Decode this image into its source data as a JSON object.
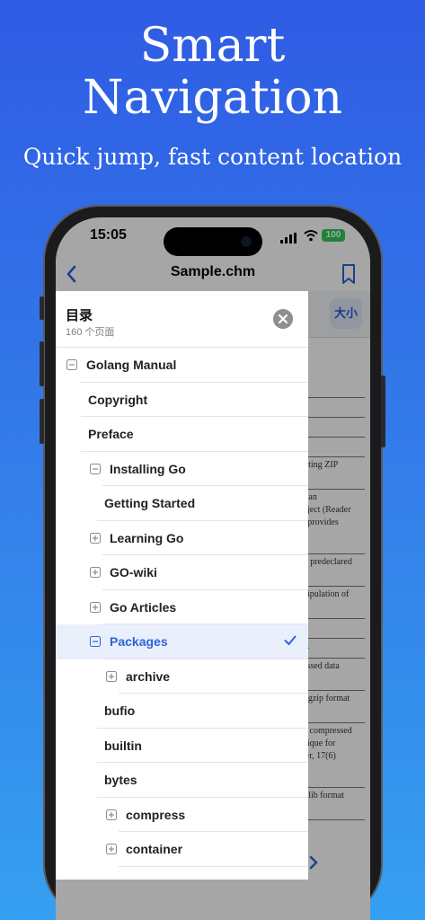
{
  "promo": {
    "title_line1": "Smart",
    "title_line2": "Navigation",
    "subtitle": "Quick jump, fast content location"
  },
  "status_bar": {
    "time": "15:05",
    "battery": "100"
  },
  "nav": {
    "title": "Sample.chm",
    "back_icon": "chevron-left-icon",
    "bookmark_icon": "bookmark-icon"
  },
  "doc_toolbar": {
    "size_button": "大小"
  },
  "doc_cells": [
    "",
    "",
    "",
    "riting ZIP",
    "s an\nbject (Reader\nt provides",
    "'s predeclared",
    "nipulation of",
    "",
    "n.",
    "essed data",
    "f gzip format",
    "n compressed\nnique for\nter, 17(6)",
    "'zlib format"
  ],
  "toc": {
    "title": "目录",
    "count": "160 个页面",
    "close_icon": "close-icon",
    "items": [
      {
        "label": "Golang Manual",
        "expander": "minus",
        "level": 0,
        "selected": false
      },
      {
        "label": "Copyright",
        "expander": "none",
        "level": 1,
        "selected": false
      },
      {
        "label": "Preface",
        "expander": "none",
        "level": 1,
        "selected": false
      },
      {
        "label": "Installing Go",
        "expander": "minus",
        "level": 1,
        "selected": false
      },
      {
        "label": "Getting Started",
        "expander": "none",
        "level": 2,
        "selected": false
      },
      {
        "label": "Learning Go",
        "expander": "plus",
        "level": 1,
        "selected": false
      },
      {
        "label": "GO-wiki",
        "expander": "plus",
        "level": 1,
        "selected": false
      },
      {
        "label": "Go Articles",
        "expander": "plus",
        "level": 1,
        "selected": false
      },
      {
        "label": "Packages",
        "expander": "minus",
        "level": 1,
        "selected": true
      },
      {
        "label": "archive",
        "expander": "plus",
        "level": 2,
        "selected": false
      },
      {
        "label": "bufio",
        "expander": "none",
        "level": 2,
        "selected": false
      },
      {
        "label": "builtin",
        "expander": "none",
        "level": 2,
        "selected": false
      },
      {
        "label": "bytes",
        "expander": "none",
        "level": 2,
        "selected": false
      },
      {
        "label": "compress",
        "expander": "plus",
        "level": 2,
        "selected": false
      },
      {
        "label": "container",
        "expander": "plus",
        "level": 2,
        "selected": false
      }
    ]
  },
  "colors": {
    "accent": "#2f63d6",
    "gradient_top": "#2f5be4",
    "gradient_bottom": "#359ff0"
  }
}
